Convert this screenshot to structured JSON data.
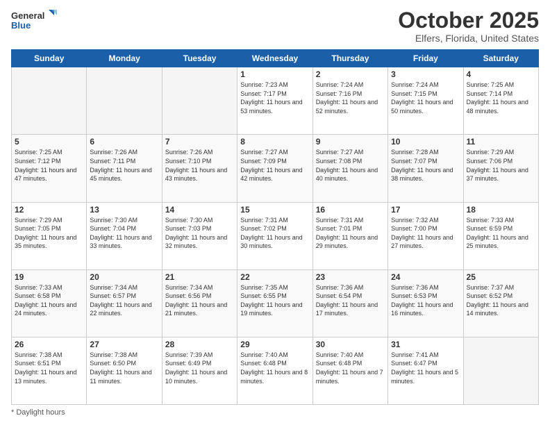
{
  "logo": {
    "line1": "General",
    "line2": "Blue"
  },
  "header": {
    "month": "October 2025",
    "location": "Elfers, Florida, United States"
  },
  "weekdays": [
    "Sunday",
    "Monday",
    "Tuesday",
    "Wednesday",
    "Thursday",
    "Friday",
    "Saturday"
  ],
  "footer": {
    "daylight_label": "Daylight hours"
  },
  "weeks": [
    [
      {
        "day": "",
        "sunrise": "",
        "sunset": "",
        "daylight": ""
      },
      {
        "day": "",
        "sunrise": "",
        "sunset": "",
        "daylight": ""
      },
      {
        "day": "",
        "sunrise": "",
        "sunset": "",
        "daylight": ""
      },
      {
        "day": "1",
        "sunrise": "7:23 AM",
        "sunset": "7:17 PM",
        "daylight": "11 hours and 53 minutes."
      },
      {
        "day": "2",
        "sunrise": "7:24 AM",
        "sunset": "7:16 PM",
        "daylight": "11 hours and 52 minutes."
      },
      {
        "day": "3",
        "sunrise": "7:24 AM",
        "sunset": "7:15 PM",
        "daylight": "11 hours and 50 minutes."
      },
      {
        "day": "4",
        "sunrise": "7:25 AM",
        "sunset": "7:14 PM",
        "daylight": "11 hours and 48 minutes."
      }
    ],
    [
      {
        "day": "5",
        "sunrise": "7:25 AM",
        "sunset": "7:12 PM",
        "daylight": "11 hours and 47 minutes."
      },
      {
        "day": "6",
        "sunrise": "7:26 AM",
        "sunset": "7:11 PM",
        "daylight": "11 hours and 45 minutes."
      },
      {
        "day": "7",
        "sunrise": "7:26 AM",
        "sunset": "7:10 PM",
        "daylight": "11 hours and 43 minutes."
      },
      {
        "day": "8",
        "sunrise": "7:27 AM",
        "sunset": "7:09 PM",
        "daylight": "11 hours and 42 minutes."
      },
      {
        "day": "9",
        "sunrise": "7:27 AM",
        "sunset": "7:08 PM",
        "daylight": "11 hours and 40 minutes."
      },
      {
        "day": "10",
        "sunrise": "7:28 AM",
        "sunset": "7:07 PM",
        "daylight": "11 hours and 38 minutes."
      },
      {
        "day": "11",
        "sunrise": "7:29 AM",
        "sunset": "7:06 PM",
        "daylight": "11 hours and 37 minutes."
      }
    ],
    [
      {
        "day": "12",
        "sunrise": "7:29 AM",
        "sunset": "7:05 PM",
        "daylight": "11 hours and 35 minutes."
      },
      {
        "day": "13",
        "sunrise": "7:30 AM",
        "sunset": "7:04 PM",
        "daylight": "11 hours and 33 minutes."
      },
      {
        "day": "14",
        "sunrise": "7:30 AM",
        "sunset": "7:03 PM",
        "daylight": "11 hours and 32 minutes."
      },
      {
        "day": "15",
        "sunrise": "7:31 AM",
        "sunset": "7:02 PM",
        "daylight": "11 hours and 30 minutes."
      },
      {
        "day": "16",
        "sunrise": "7:31 AM",
        "sunset": "7:01 PM",
        "daylight": "11 hours and 29 minutes."
      },
      {
        "day": "17",
        "sunrise": "7:32 AM",
        "sunset": "7:00 PM",
        "daylight": "11 hours and 27 minutes."
      },
      {
        "day": "18",
        "sunrise": "7:33 AM",
        "sunset": "6:59 PM",
        "daylight": "11 hours and 25 minutes."
      }
    ],
    [
      {
        "day": "19",
        "sunrise": "7:33 AM",
        "sunset": "6:58 PM",
        "daylight": "11 hours and 24 minutes."
      },
      {
        "day": "20",
        "sunrise": "7:34 AM",
        "sunset": "6:57 PM",
        "daylight": "11 hours and 22 minutes."
      },
      {
        "day": "21",
        "sunrise": "7:34 AM",
        "sunset": "6:56 PM",
        "daylight": "11 hours and 21 minutes."
      },
      {
        "day": "22",
        "sunrise": "7:35 AM",
        "sunset": "6:55 PM",
        "daylight": "11 hours and 19 minutes."
      },
      {
        "day": "23",
        "sunrise": "7:36 AM",
        "sunset": "6:54 PM",
        "daylight": "11 hours and 17 minutes."
      },
      {
        "day": "24",
        "sunrise": "7:36 AM",
        "sunset": "6:53 PM",
        "daylight": "11 hours and 16 minutes."
      },
      {
        "day": "25",
        "sunrise": "7:37 AM",
        "sunset": "6:52 PM",
        "daylight": "11 hours and 14 minutes."
      }
    ],
    [
      {
        "day": "26",
        "sunrise": "7:38 AM",
        "sunset": "6:51 PM",
        "daylight": "11 hours and 13 minutes."
      },
      {
        "day": "27",
        "sunrise": "7:38 AM",
        "sunset": "6:50 PM",
        "daylight": "11 hours and 11 minutes."
      },
      {
        "day": "28",
        "sunrise": "7:39 AM",
        "sunset": "6:49 PM",
        "daylight": "11 hours and 10 minutes."
      },
      {
        "day": "29",
        "sunrise": "7:40 AM",
        "sunset": "6:48 PM",
        "daylight": "11 hours and 8 minutes."
      },
      {
        "day": "30",
        "sunrise": "7:40 AM",
        "sunset": "6:48 PM",
        "daylight": "11 hours and 7 minutes."
      },
      {
        "day": "31",
        "sunrise": "7:41 AM",
        "sunset": "6:47 PM",
        "daylight": "11 hours and 5 minutes."
      },
      {
        "day": "",
        "sunrise": "",
        "sunset": "",
        "daylight": ""
      }
    ]
  ]
}
